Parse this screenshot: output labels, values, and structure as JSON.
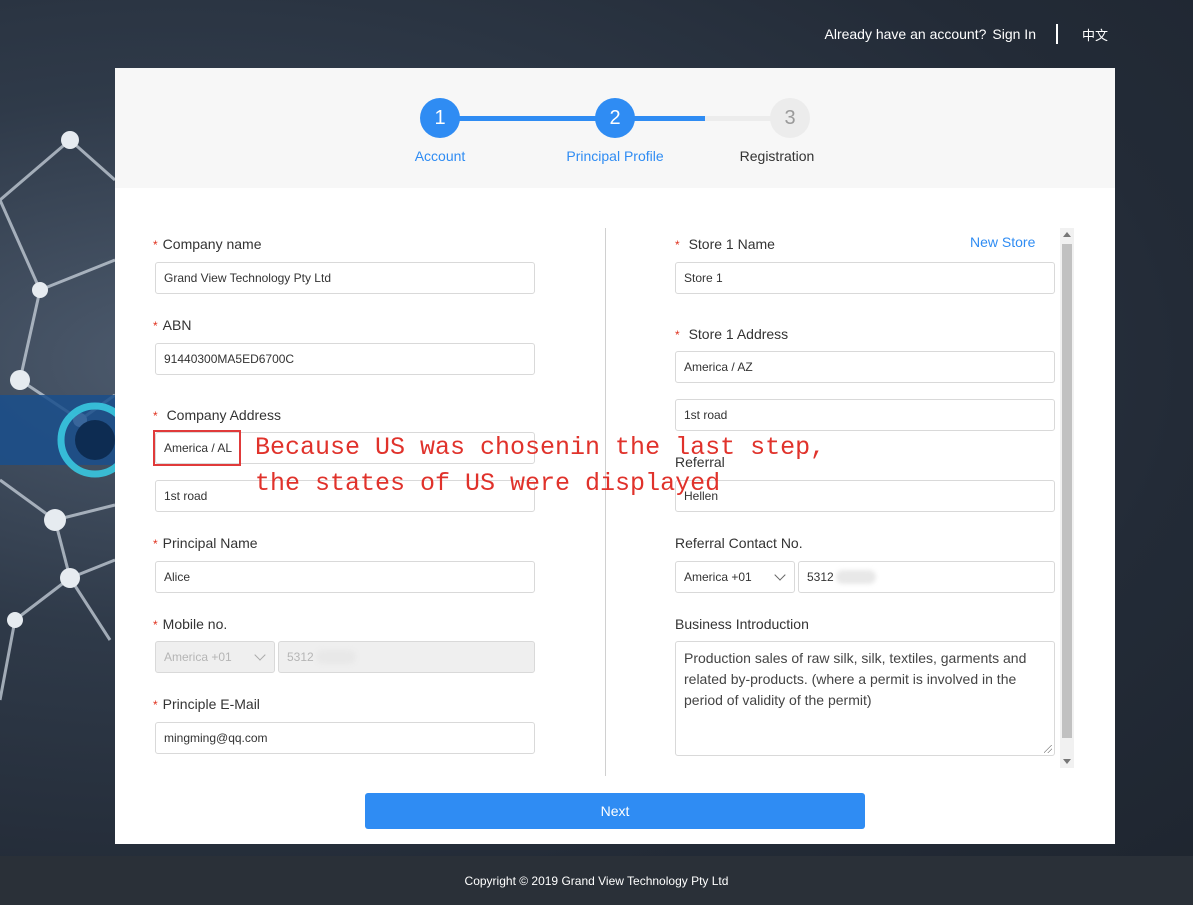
{
  "header": {
    "already_text": "Already have an account?",
    "signin": "Sign In",
    "language": "中文"
  },
  "steps": [
    {
      "number": "1",
      "label": "Account",
      "state": "done"
    },
    {
      "number": "2",
      "label": "Principal Profile",
      "state": "active"
    },
    {
      "number": "3",
      "label": "Registration",
      "state": "pending"
    }
  ],
  "left": {
    "company_name": {
      "label": "Company name",
      "value": "Grand View Technology Pty Ltd"
    },
    "abn": {
      "label": "ABN",
      "value": "91440300MA5ED6700C"
    },
    "company_address": {
      "label": "Company Address",
      "region": "America / AL",
      "street": "1st road"
    },
    "principal_name": {
      "label": "Principal Name",
      "value": "Alice"
    },
    "mobile": {
      "label": "Mobile no.",
      "country_code": "America +01",
      "number": "5312"
    },
    "email": {
      "label": "Principle E-Mail",
      "value": "mingming@qq.com"
    }
  },
  "right": {
    "new_store": "New Store",
    "store_name": {
      "label": "Store 1 Name",
      "value": "Store 1"
    },
    "store_address": {
      "label": "Store 1 Address",
      "region": "America / AZ",
      "street": "1st road"
    },
    "referral": {
      "label": "Referral",
      "value": "Hellen"
    },
    "referral_contact": {
      "label": "Referral Contact No.",
      "country_code": "America +01",
      "number": "5312"
    },
    "business_intro": {
      "label": "Business Introduction",
      "value": "Production sales of raw silk, silk, textiles, garments and related by-products. (where a permit is involved in the period of validity of the permit)"
    }
  },
  "next_button": "Next",
  "annotation": {
    "line1": "Because US was chosenin the last step,",
    "line2": "the states of US were displayed"
  },
  "footer": "Copyright © 2019 Grand View Technology Pty Ltd",
  "colors": {
    "accent": "#2f8cf3",
    "required": "#e0321f",
    "annotation": "#e0322b"
  }
}
